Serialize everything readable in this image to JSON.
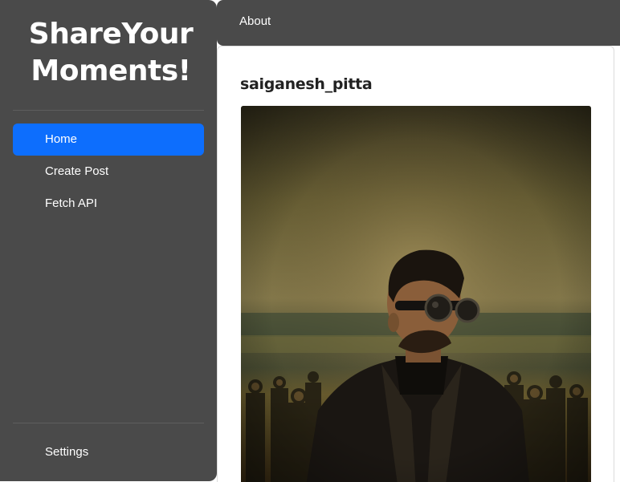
{
  "sidebar": {
    "brand_line1": "ShareYour",
    "brand_line2": "Moments!",
    "items": [
      {
        "label": "Home",
        "active": true
      },
      {
        "label": "Create Post",
        "active": false
      },
      {
        "label": "Fetch API",
        "active": false
      }
    ],
    "settings_label": "Settings"
  },
  "header": {
    "about_label": "About"
  },
  "post": {
    "username": "saiganesh_pitta",
    "image_icon": "portrait-photo"
  },
  "colors": {
    "sidebar_bg": "#4a4a4a",
    "active": "#0d6efd",
    "text": "#ffffff"
  }
}
